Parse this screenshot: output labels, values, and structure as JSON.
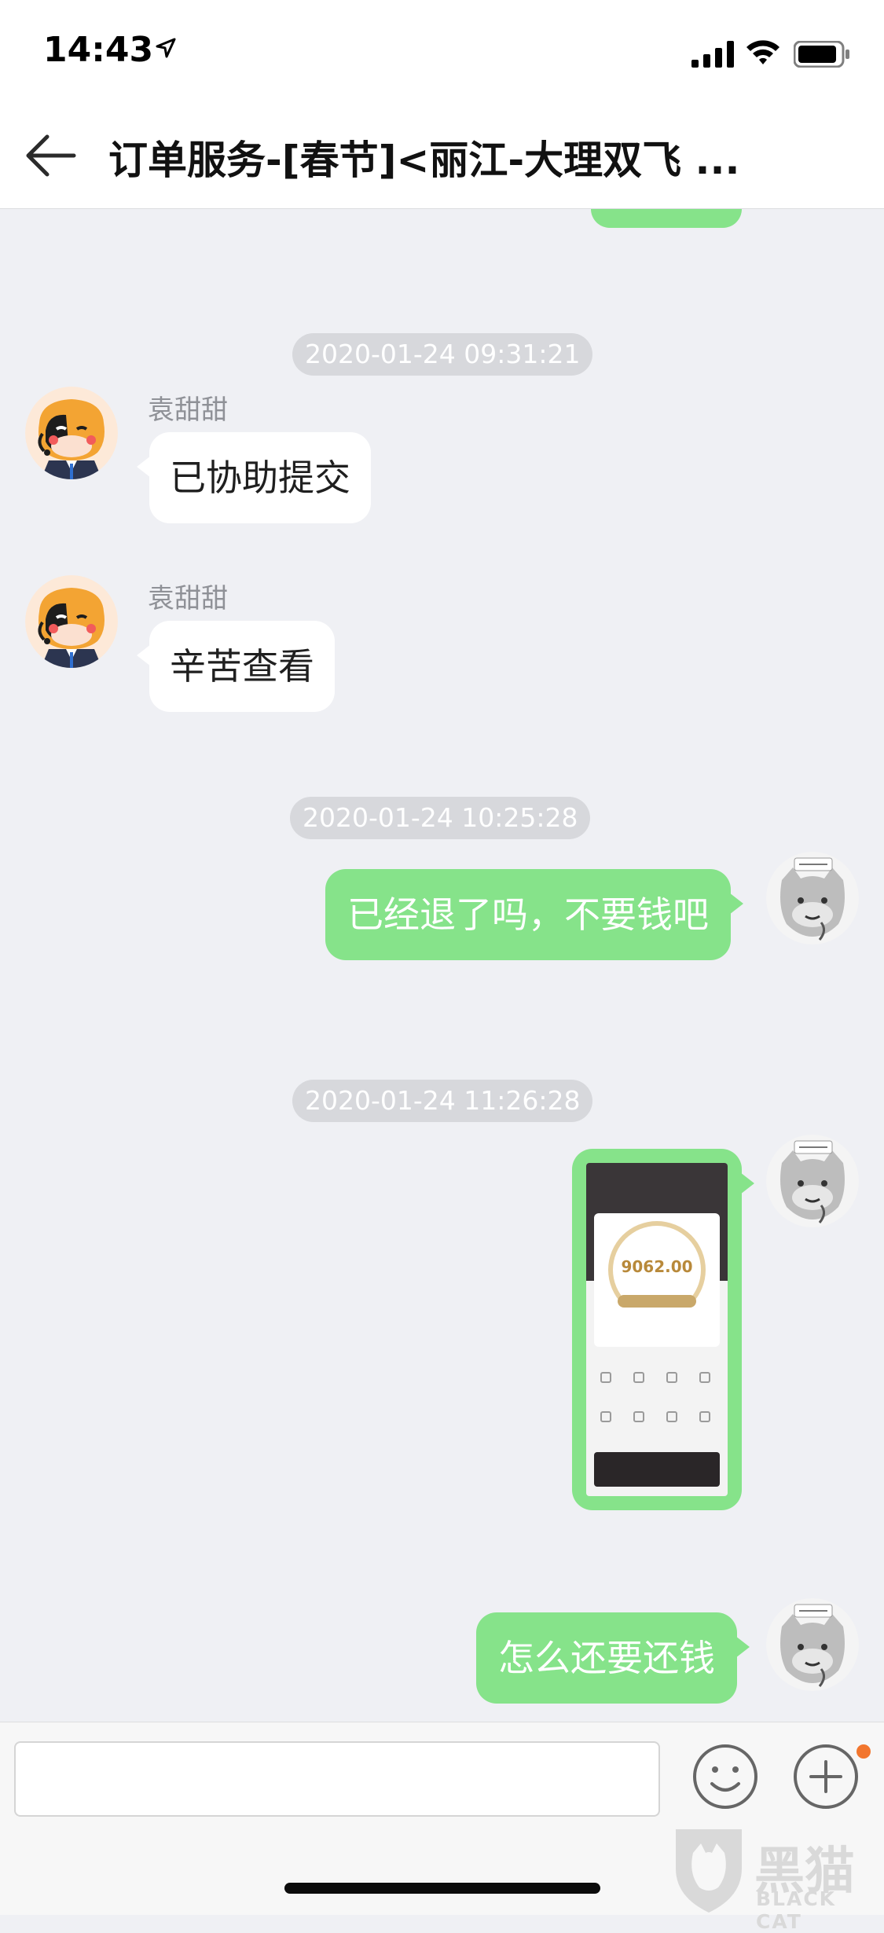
{
  "status_bar": {
    "time": "14:43"
  },
  "header": {
    "title": "订单服务-[春节]<丽江-大理双飞 ..."
  },
  "timestamps": [
    "2020-01-24 09:31:21",
    "2020-01-24 10:25:28",
    "2020-01-24 11:26:28"
  ],
  "messages": [
    {
      "side": "left",
      "sender": "袁甜甜",
      "text": "已协助提交"
    },
    {
      "side": "left",
      "sender": "袁甜甜",
      "text": "辛苦查看"
    },
    {
      "side": "right",
      "text": "已经退了吗，不要钱吧"
    },
    {
      "side": "right",
      "type": "image",
      "image_amount": "9062.00"
    },
    {
      "side": "right",
      "text": "怎么还要还钱"
    }
  ],
  "watermark": {
    "brand": "黑猫",
    "brand_en": "BLACK CAT"
  },
  "colors": {
    "bubble_green": "#86e38a",
    "background": "#eff0f4",
    "badge": "#f2762e"
  }
}
